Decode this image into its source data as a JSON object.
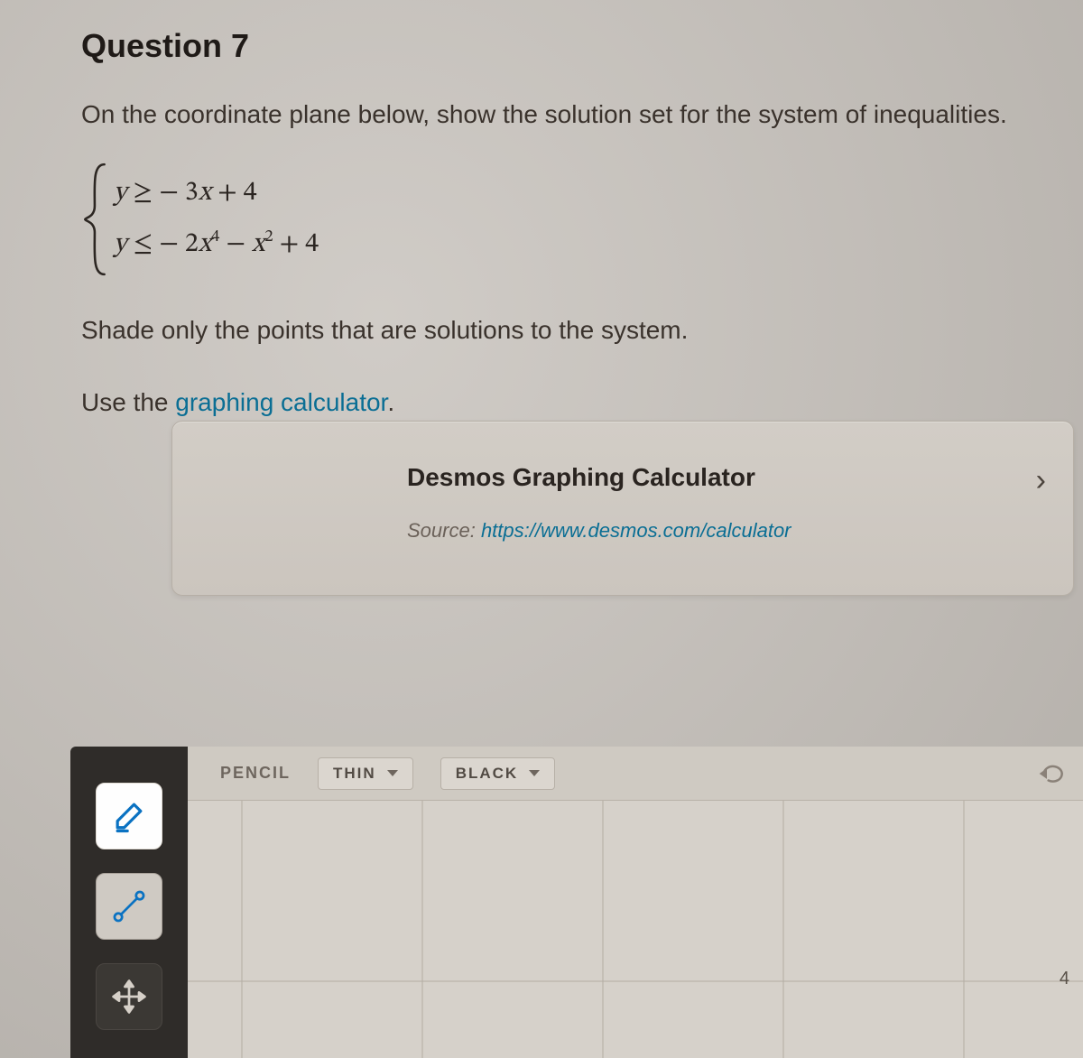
{
  "question": {
    "title": "Question 7",
    "prompt": "On the coordinate plane below, show the solution set for the system of inequalities.",
    "inequalities": [
      "y ≥ − 3x + 4",
      "y ≤ − 2x⁴ − x² + 4"
    ],
    "shade_instruction": "Shade only the points that are solutions to the system.",
    "use_prefix": "Use the ",
    "use_link": "graphing calculator",
    "use_suffix": "."
  },
  "card": {
    "title": "Desmos Graphing Calculator",
    "source_label": "Source: ",
    "source_url": "https://www.desmos.com/calculator",
    "chevron": "›"
  },
  "toolbar": {
    "pencil_label": "PENCIL",
    "thickness": "THIN",
    "color": "BLACK"
  },
  "grid": {
    "axis_label_right": "4"
  }
}
